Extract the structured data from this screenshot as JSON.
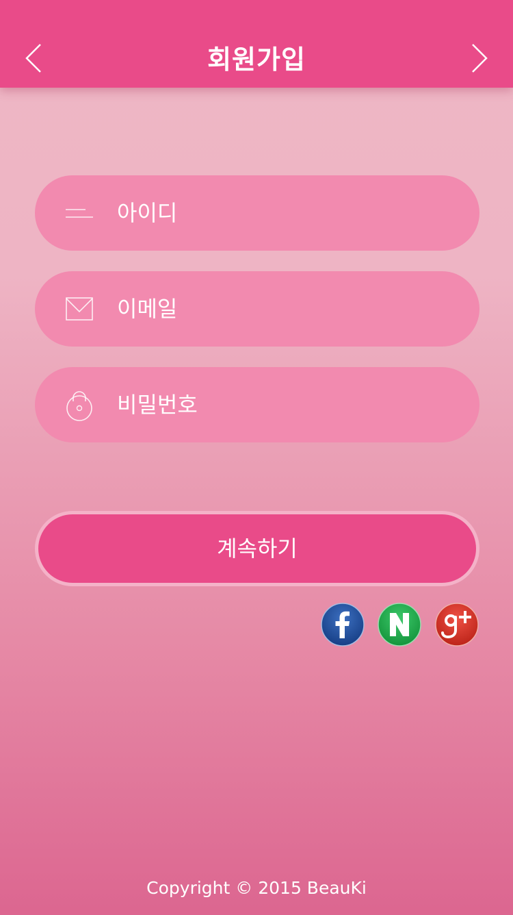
{
  "header": {
    "title": "회원가입"
  },
  "form": {
    "id_placeholder": "아이디",
    "email_placeholder": "이메일",
    "password_placeholder": "비밀번호",
    "continue_label": "계속하기"
  },
  "icons": {
    "back": "chevron-left-icon",
    "forward": "chevron-right-icon",
    "id_field": "id-lines-icon",
    "email_field": "envelope-icon",
    "password_field": "padlock-icon",
    "facebook": "facebook-icon",
    "naver": "naver-icon",
    "google": "google-plus-icon"
  },
  "colors": {
    "accent": "#e94b89",
    "field_background": "#f28aaf",
    "facebook": "#1f4e96",
    "naver": "#1fae4a",
    "google": "#d9362b"
  },
  "footer": {
    "copyright": "Copyright © 2015 BeauKi"
  }
}
